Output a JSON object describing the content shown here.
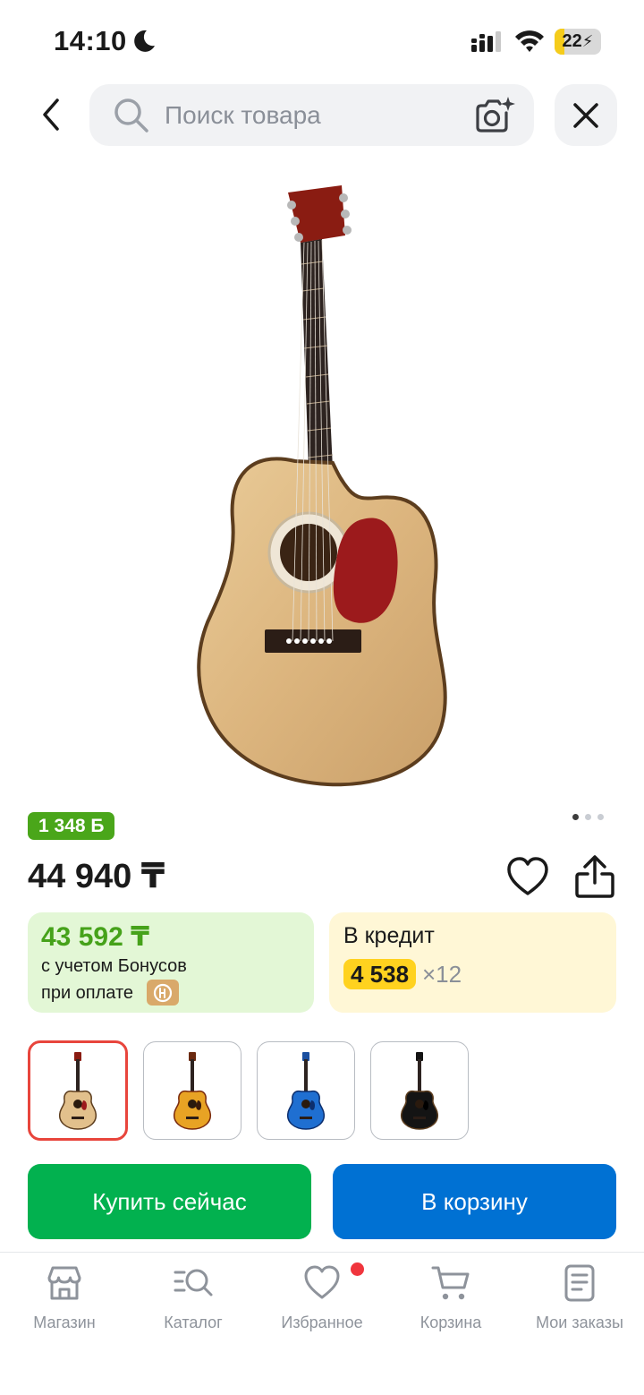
{
  "status_bar": {
    "time": "14:10",
    "battery_percent": 22,
    "battery_label": "22",
    "icons": [
      "moon-icon",
      "signal-icon",
      "wifi-icon",
      "battery-icon"
    ]
  },
  "search": {
    "placeholder": "Поиск товара",
    "value": ""
  },
  "product": {
    "bonus_badge": "1 348 Б",
    "price": "44 940 ₸",
    "image_count": 3,
    "active_image_index": 0
  },
  "bonus_card": {
    "price": "43 592 ₸",
    "line1": "с учетом Бонусов",
    "line2": "при оплате"
  },
  "credit_card": {
    "title": "В кредит",
    "monthly_amount": "4 538",
    "term": "×12"
  },
  "variants": [
    {
      "color": "natural",
      "selected": true
    },
    {
      "color": "sunburst",
      "selected": false
    },
    {
      "color": "blue",
      "selected": false
    },
    {
      "color": "black",
      "selected": false
    }
  ],
  "actions": {
    "buy_now": "Купить сейчас",
    "add_to_cart": "В корзину"
  },
  "colors": {
    "buy_green": "#02b14f",
    "cart_blue": "#0071d3",
    "bonus_green": "#4aa61a",
    "credit_yellow": "#ffd21f",
    "selected_red": "#e8453c",
    "notification_red": "#f0353d"
  },
  "tab_bar": {
    "items": [
      {
        "label": "Магазин",
        "icon": "store-icon"
      },
      {
        "label": "Каталог",
        "icon": "catalog-icon"
      },
      {
        "label": "Избранное",
        "icon": "heart-icon",
        "has_notification": true
      },
      {
        "label": "Корзина",
        "icon": "cart-icon"
      },
      {
        "label": "Мои заказы",
        "icon": "orders-icon"
      }
    ]
  }
}
